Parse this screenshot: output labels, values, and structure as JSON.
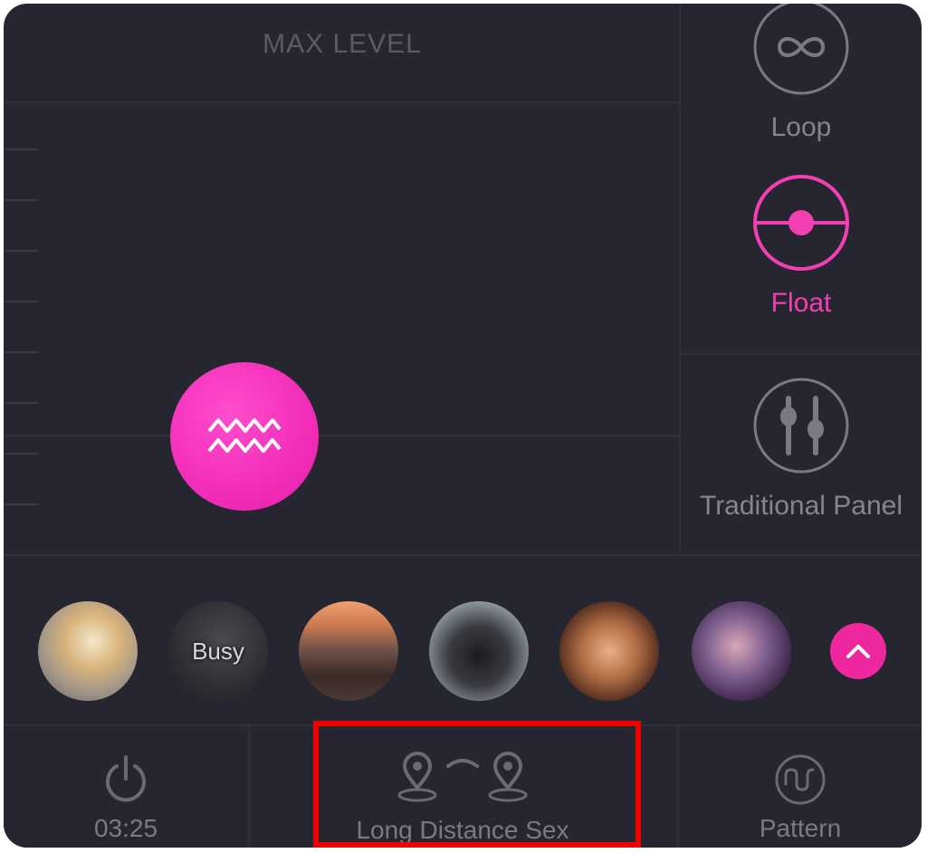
{
  "graph": {
    "max_level_label": "MAX LEVEL",
    "wave_button_icon": "wave-icon"
  },
  "modes": [
    {
      "label": "Loop",
      "icon": "infinity-icon",
      "active": false
    },
    {
      "label": "Float",
      "icon": "float-icon",
      "active": true
    },
    {
      "label": "Traditional Panel",
      "icon": "sliders-icon",
      "active": false
    }
  ],
  "users": [
    {
      "name": "avatar-user-1",
      "status": ""
    },
    {
      "name": "avatar-user-2",
      "status": "Busy"
    },
    {
      "name": "avatar-user-3",
      "status": ""
    },
    {
      "name": "avatar-user-4",
      "status": ""
    },
    {
      "name": "avatar-user-5",
      "status": ""
    },
    {
      "name": "avatar-user-6",
      "status": ""
    }
  ],
  "expand_icon": "chevron-up-icon",
  "bottom_bar": {
    "timer": {
      "label": "03:25",
      "icon": "power-icon"
    },
    "long_distance": {
      "label": "Long Distance Sex",
      "icon": "location-pins-icon"
    },
    "pattern": {
      "label": "Pattern",
      "icon": "pattern-icon"
    }
  },
  "colors": {
    "background": "#262630",
    "accent": "#f23fb4",
    "inactive": "#85858f",
    "highlight": "#f20000"
  }
}
